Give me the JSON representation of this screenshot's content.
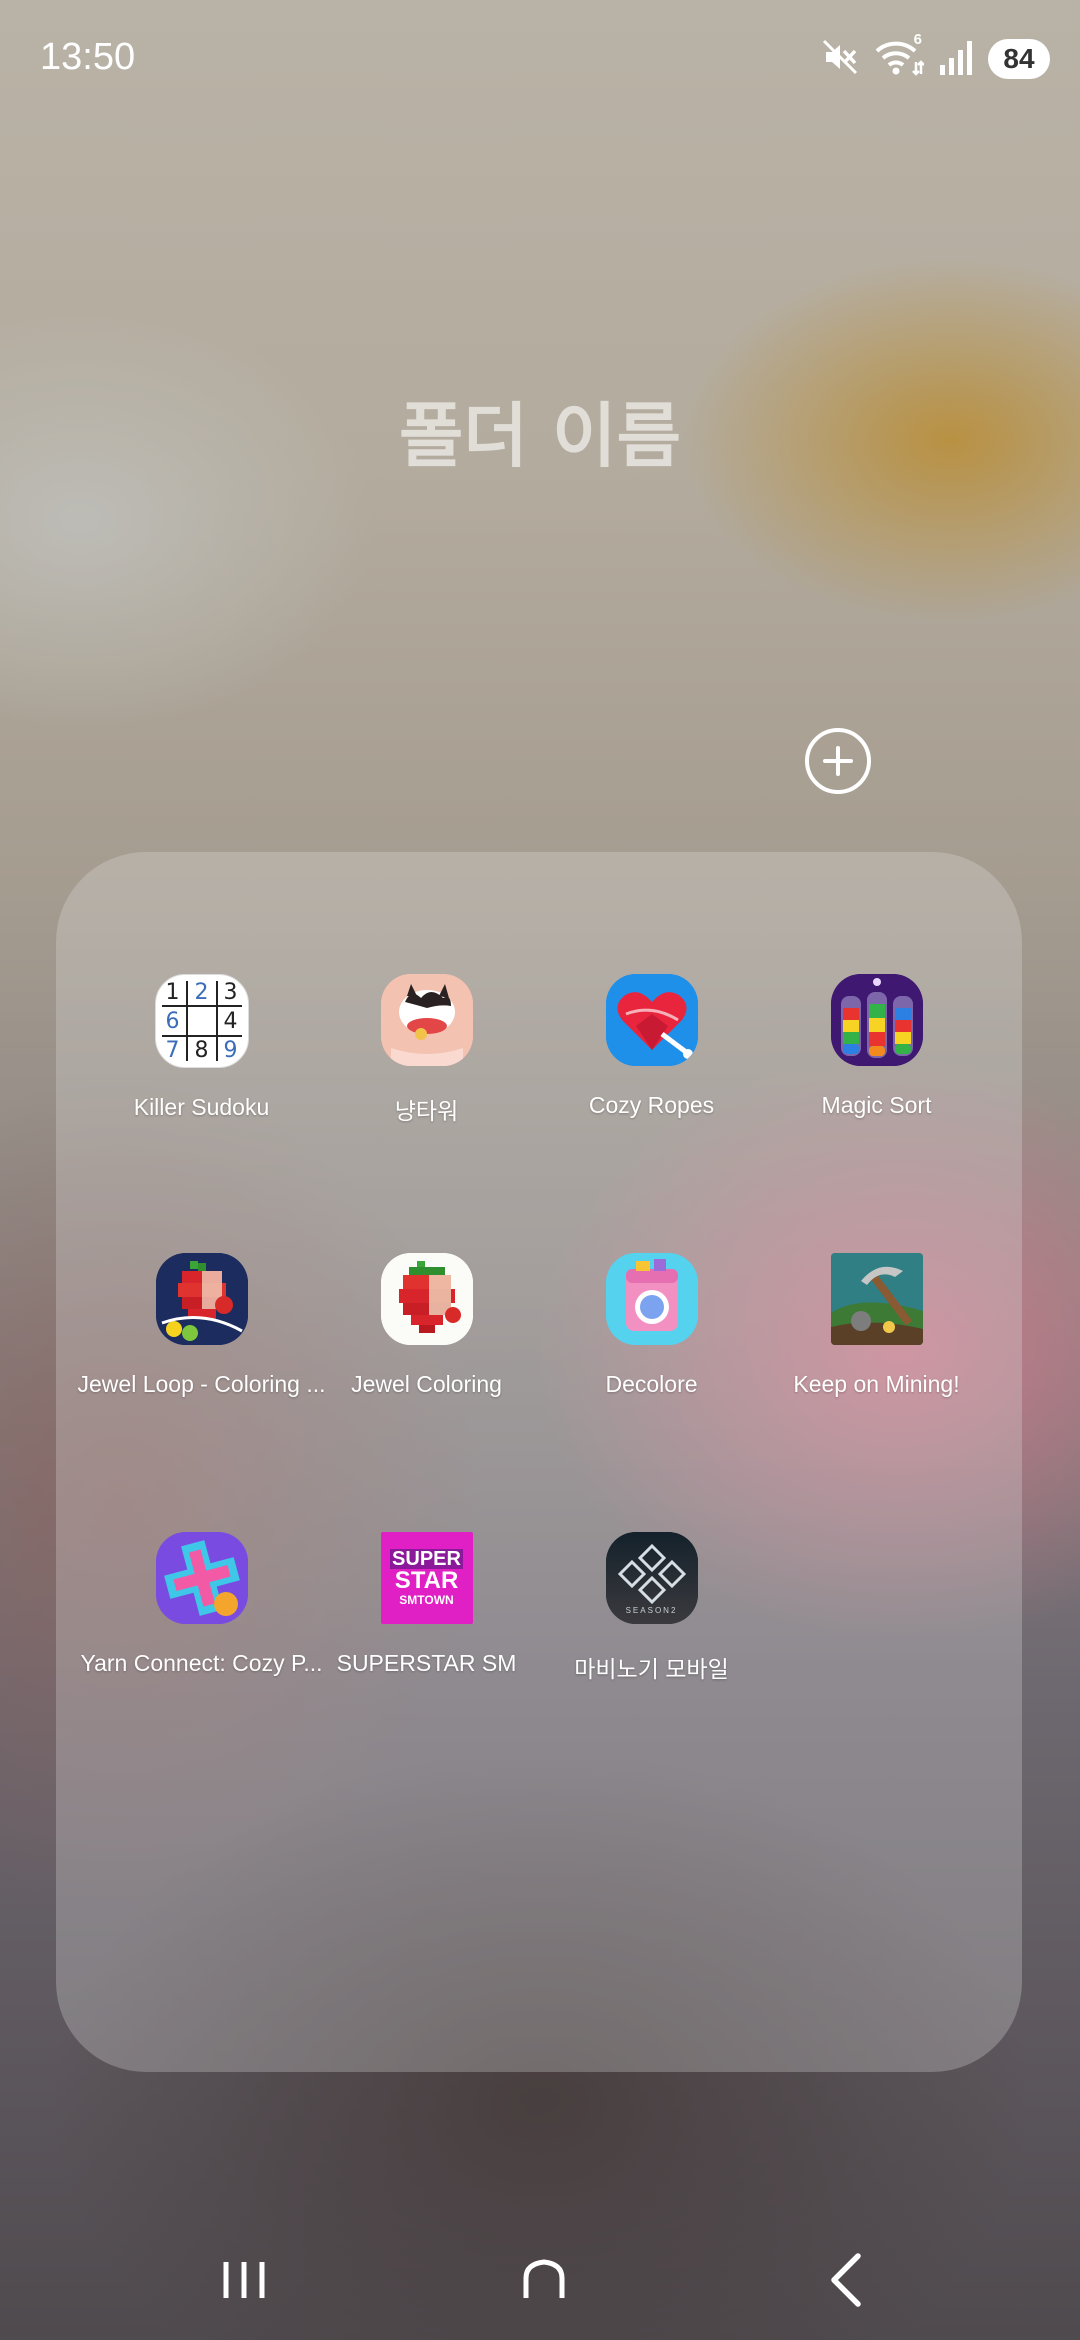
{
  "status_bar": {
    "time": "13:50",
    "battery_level": "84",
    "wifi_badge": "6",
    "icons": [
      "mute-icon",
      "wifi-icon",
      "signal-icon"
    ]
  },
  "folder": {
    "title": "폴더 이름",
    "apps": [
      {
        "label": "Killer Sudoku",
        "icon": "killer-sudoku-icon"
      },
      {
        "label": "냥타워",
        "icon": "cat-tower-icon"
      },
      {
        "label": "Cozy Ropes",
        "icon": "heart-rope-icon"
      },
      {
        "label": "Magic Sort",
        "icon": "color-bottles-icon"
      },
      {
        "label": "Jewel Loop - Coloring ...",
        "icon": "pixel-strawberry-loop-icon"
      },
      {
        "label": "Jewel Coloring",
        "icon": "pixel-strawberry-icon"
      },
      {
        "label": "Decolore",
        "icon": "washing-machine-icon"
      },
      {
        "label": "Keep on Mining!",
        "icon": "pickaxe-mining-icon"
      },
      {
        "label": "Yarn Connect: Cozy P...",
        "icon": "yarn-cross-icon"
      },
      {
        "label": "SUPERSTAR SM",
        "icon": "superstar-smtown-icon"
      },
      {
        "label": "마비노기 모바일",
        "icon": "mabinogi-knot-icon"
      }
    ]
  },
  "superstar_icon_text": {
    "line1": "SUPER",
    "line2": "STAR",
    "line3": "SMTOWN"
  },
  "sudoku_icon_digits": [
    "1",
    "2",
    "3",
    "6",
    "4",
    "7",
    "8",
    "9"
  ],
  "mabinogi_icon_text": "SEASON2",
  "nav_bar": {
    "icons": [
      "recent-apps-icon",
      "home-icon",
      "back-icon"
    ]
  }
}
